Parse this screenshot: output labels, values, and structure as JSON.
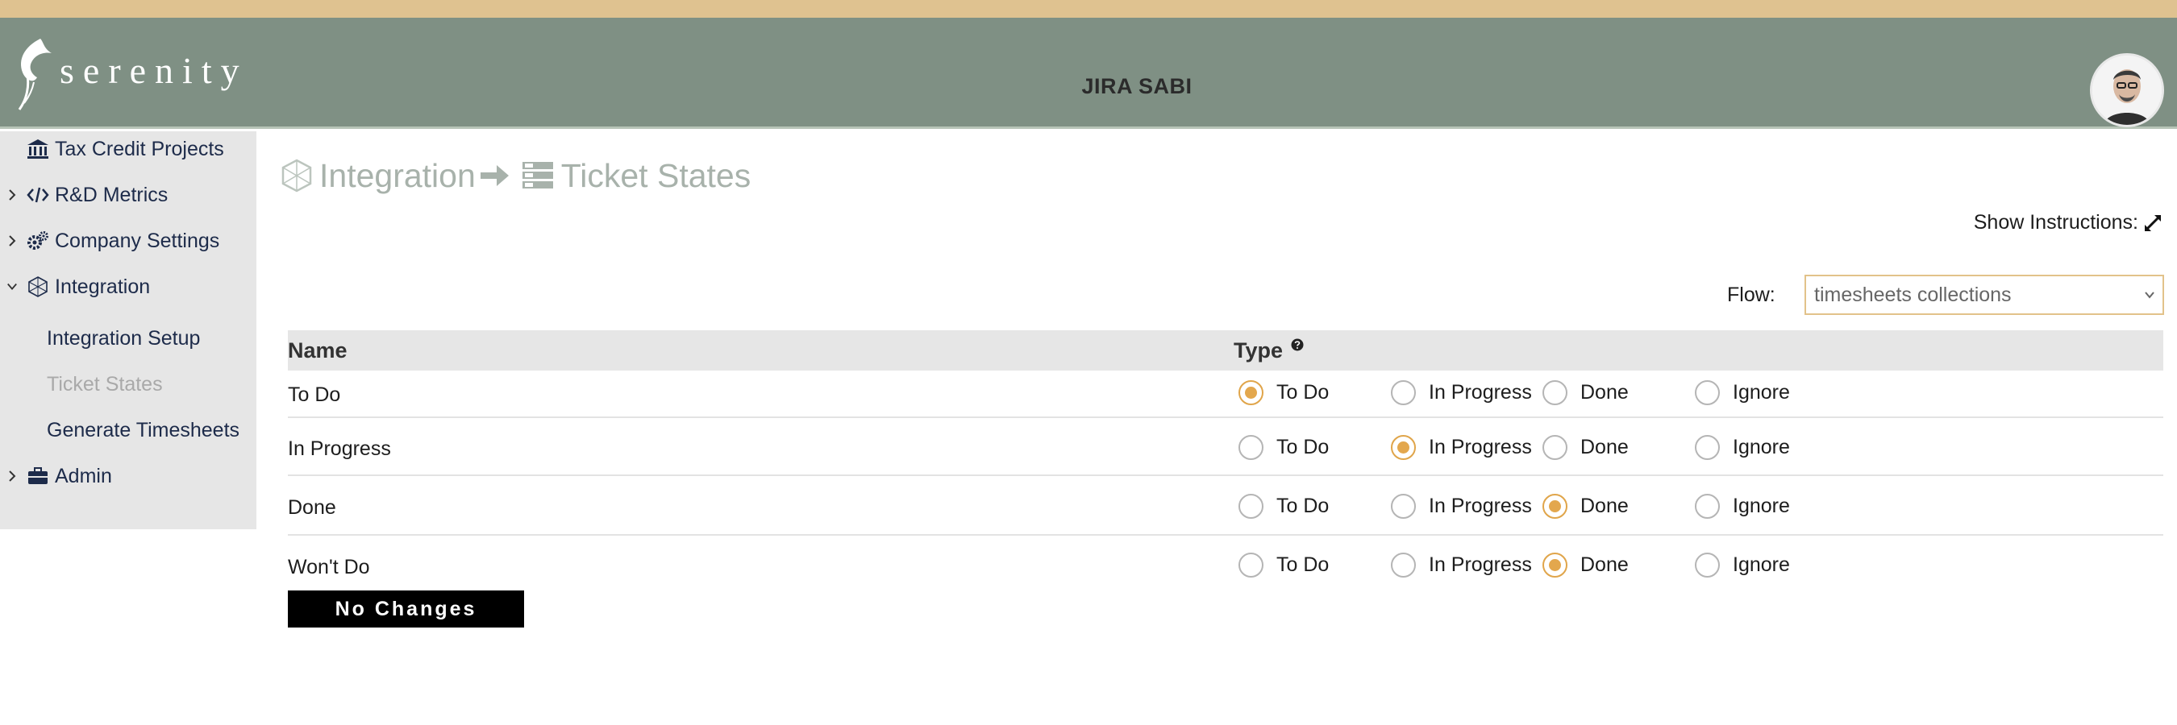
{
  "brand": {
    "logo_text": "serenity"
  },
  "header": {
    "title": "JIRA SABI"
  },
  "colors": {
    "top_strip": "#dfc290",
    "header_bg": "#7f9084",
    "sidebar_bg": "#e6e6e6",
    "accent": "#e3a74d",
    "muted": "#a8b2ab"
  },
  "sidebar": {
    "items": [
      {
        "label": "Tax Credit Projects",
        "icon": "bank-icon",
        "expandable": false
      },
      {
        "label": "R&D Metrics",
        "icon": "code-icon",
        "expandable": true,
        "expanded": false
      },
      {
        "label": "Company Settings",
        "icon": "gears-icon",
        "expandable": true,
        "expanded": false
      },
      {
        "label": "Integration",
        "icon": "integration-icon",
        "expandable": true,
        "expanded": true
      },
      {
        "label": "Admin",
        "icon": "briefcase-icon",
        "expandable": true,
        "expanded": false
      }
    ],
    "sub_items": [
      {
        "label": "Integration Setup",
        "active": false
      },
      {
        "label": "Ticket States",
        "active": true
      },
      {
        "label": "Generate Timesheets",
        "active": false
      }
    ]
  },
  "breadcrumb": {
    "parent": "Integration",
    "current": "Ticket States"
  },
  "instructions": {
    "label": "Show Instructions:"
  },
  "flow": {
    "label": "Flow:",
    "selected": "timesheets collections"
  },
  "table": {
    "headers": {
      "name": "Name",
      "type": "Type"
    },
    "options": [
      "To Do",
      "In Progress",
      "Done",
      "Ignore"
    ],
    "rows": [
      {
        "name": "To Do",
        "selected": "To Do"
      },
      {
        "name": "In Progress",
        "selected": "In Progress"
      },
      {
        "name": "Done",
        "selected": "Done"
      },
      {
        "name": "Won't Do",
        "selected": "Done"
      }
    ]
  },
  "actions": {
    "no_changes": "No Changes"
  }
}
